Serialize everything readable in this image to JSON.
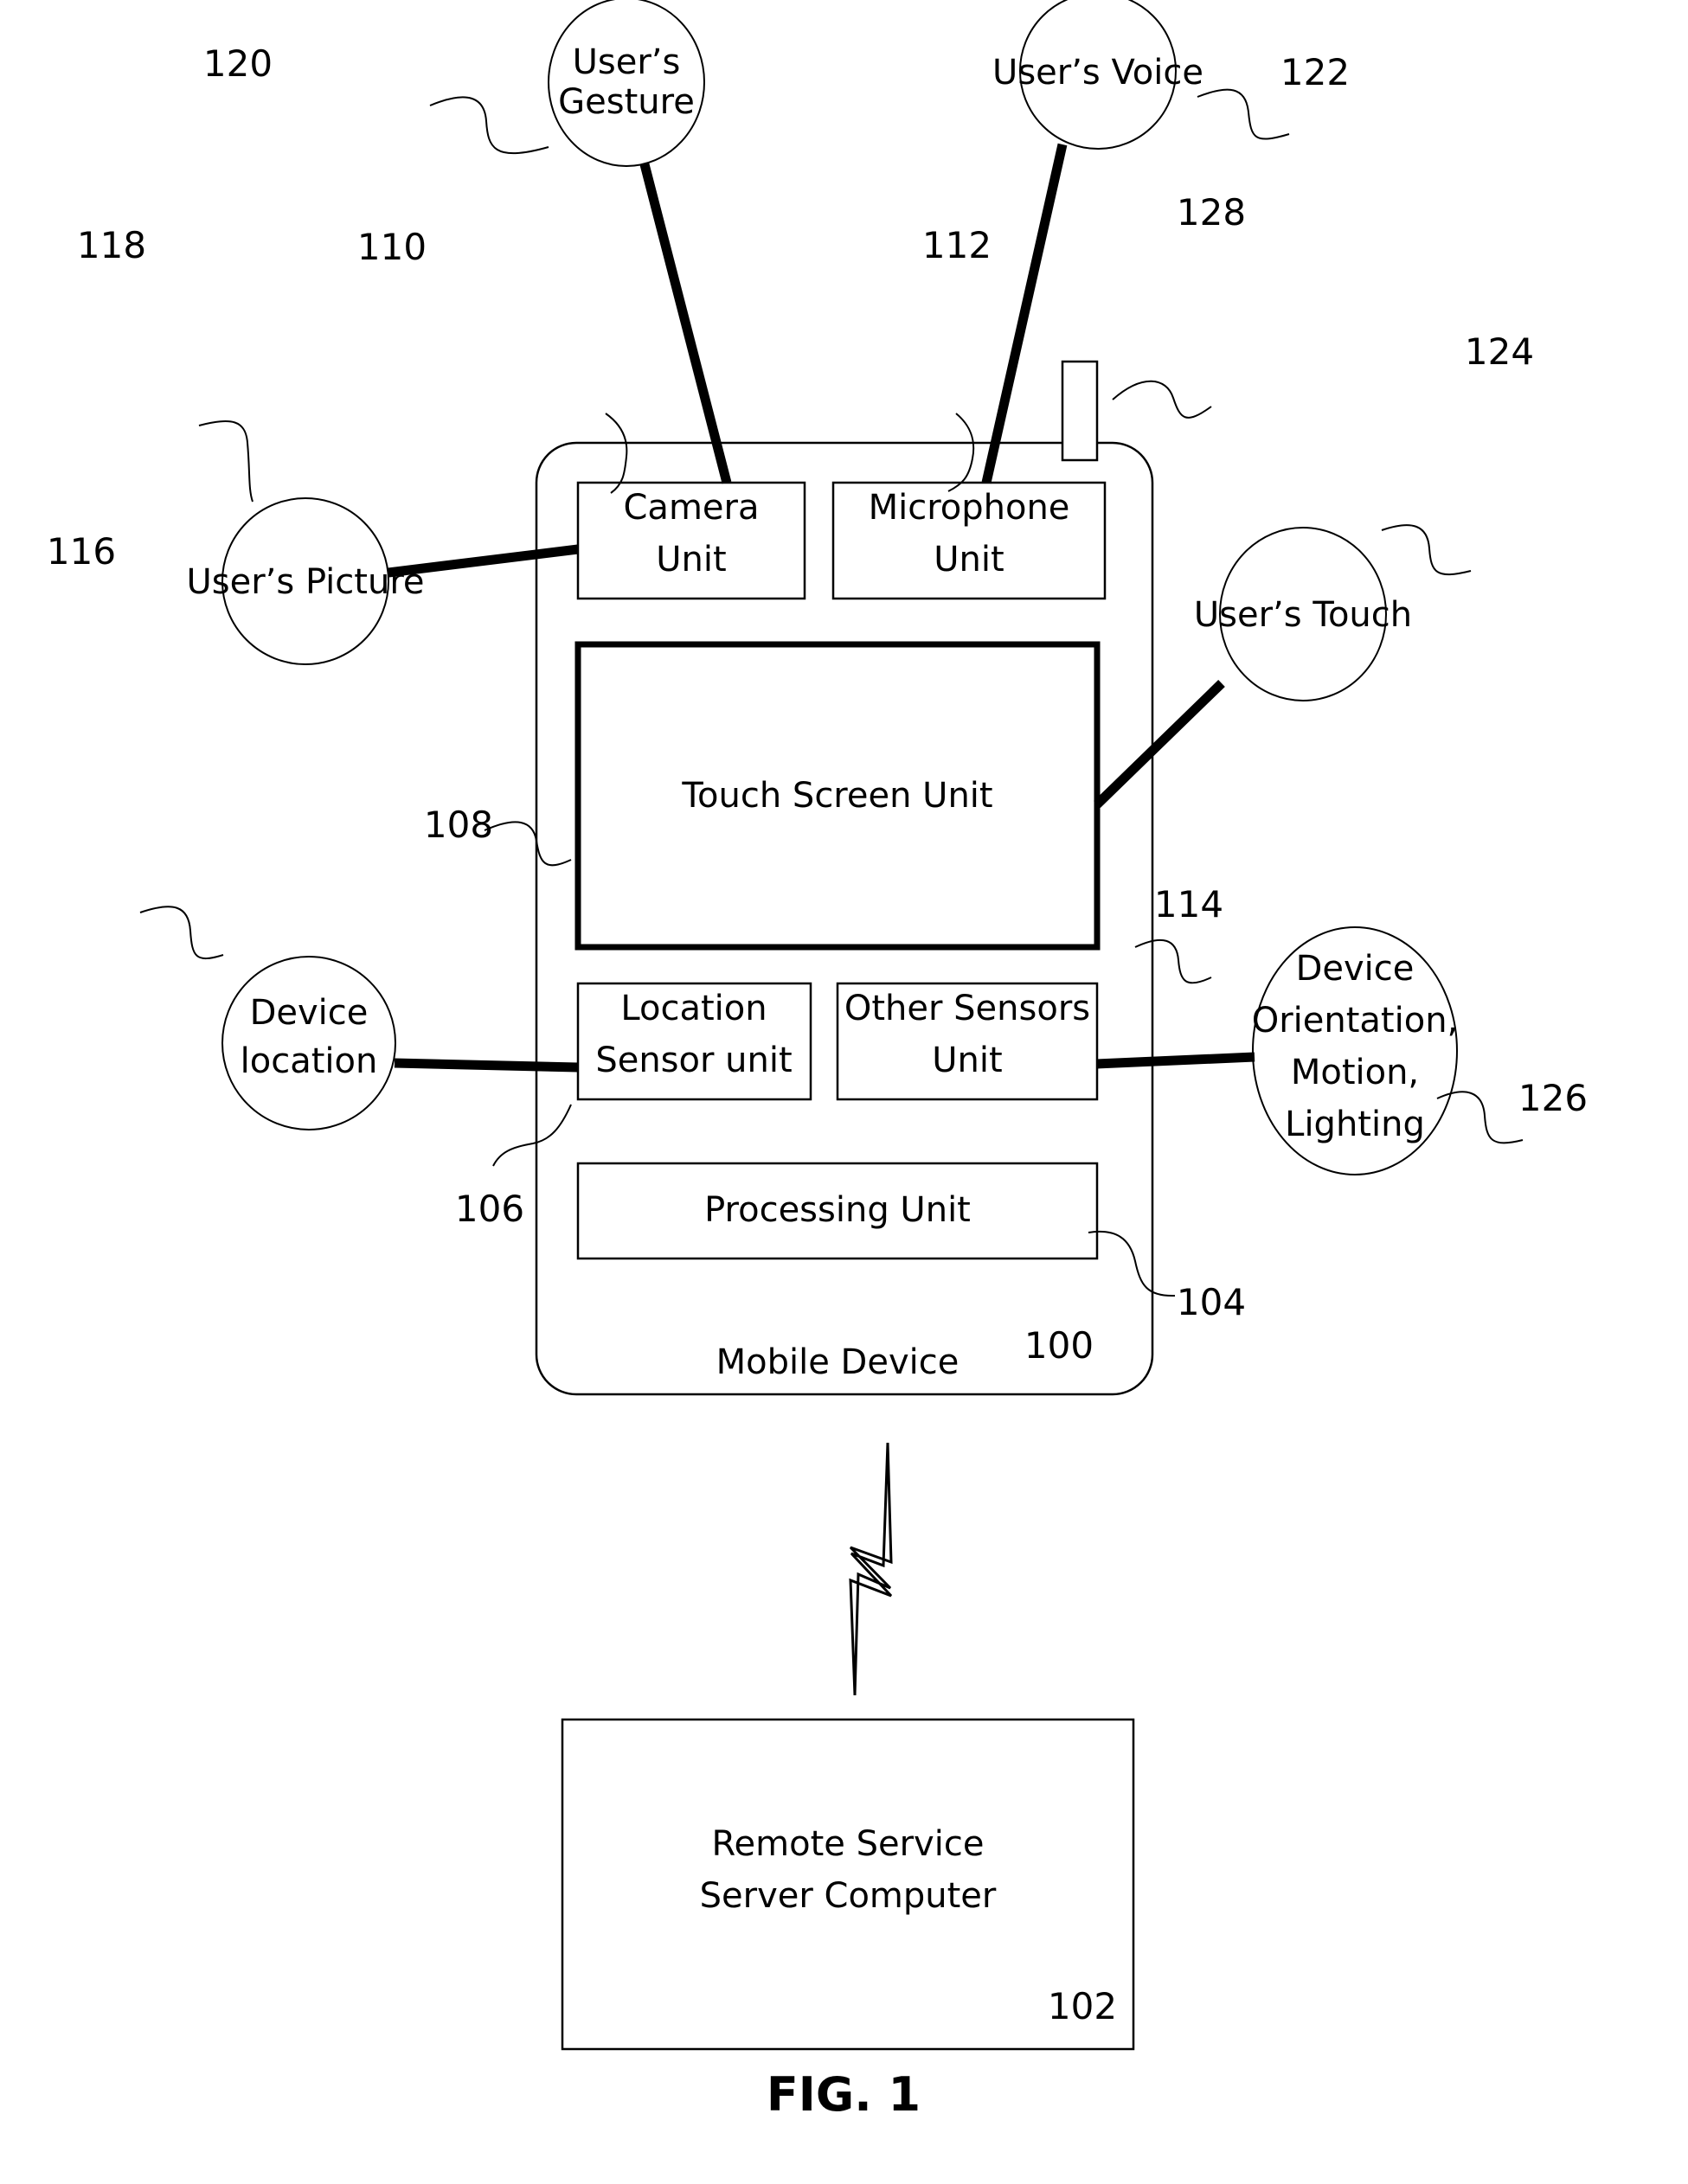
{
  "figure": {
    "caption": "FIG. 1"
  },
  "device": {
    "name": "Mobile Device",
    "ref": "100",
    "antenna_ref": "128",
    "units": [
      {
        "id": "camera",
        "label_line1": "Camera",
        "label_line2": "Unit",
        "ref": "110"
      },
      {
        "id": "microphone",
        "label_line1": "Microphone",
        "label_line2": "Unit",
        "ref": "112"
      },
      {
        "id": "touchscreen",
        "label_line1": "Touch Screen Unit",
        "label_line2": "",
        "ref": "108"
      },
      {
        "id": "location-sensor",
        "label_line1": "Location",
        "label_line2": "Sensor unit",
        "ref": "106"
      },
      {
        "id": "other-sensors",
        "label_line1": "Other Sensors",
        "label_line2": "Unit",
        "ref": "114"
      },
      {
        "id": "processing",
        "label_line1": "Processing Unit",
        "label_line2": "",
        "ref": "104"
      }
    ]
  },
  "server": {
    "label_line1": "Remote Service",
    "label_line2": "Server Computer",
    "ref": "102"
  },
  "inputs": [
    {
      "id": "gesture",
      "line1": "User’s",
      "line2": "Gesture",
      "line3": "",
      "ref": "120"
    },
    {
      "id": "voice",
      "line1": "User’s Voice",
      "line2": "",
      "line3": "",
      "ref": "122"
    },
    {
      "id": "picture",
      "line1": "User’s Picture",
      "line2": "",
      "line3": "",
      "ref": "118"
    },
    {
      "id": "touch",
      "line1": "User’s Touch",
      "line2": "",
      "line3": "",
      "ref": "124"
    },
    {
      "id": "location",
      "line1": "Device",
      "line2": "location",
      "line3": "",
      "ref": "116"
    },
    {
      "id": "orientation",
      "line1": "Device",
      "line2": "Orientation,",
      "line3": "Motion,",
      "line4": "Lighting",
      "ref": "126"
    }
  ],
  "colors": {
    "ink": "#000000",
    "paper": "#ffffff"
  }
}
